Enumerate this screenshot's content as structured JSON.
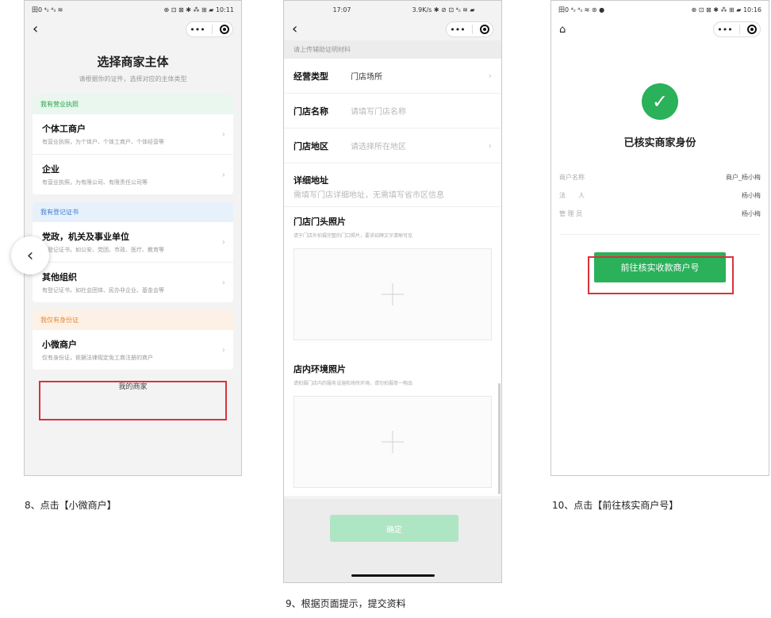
{
  "screen1": {
    "status_left": "田0 ⁴ᵢₗ ⁴ᵢₗ ≋",
    "status_right": "⊕ ⊡ ⊠ ✱ ⁂ ⊞ ▰ 10:11",
    "title": "选择商家主体",
    "subtitle": "请根据你的证件，选择对应的主体类型",
    "groups": [
      {
        "header": "我有营业执照",
        "options": [
          {
            "title": "个体工商户",
            "desc": "有营业执照，为个体户、个体工商户、个体经营等"
          },
          {
            "title": "企业",
            "desc": "有营业执照，为有限公司、有限责任公司等"
          }
        ]
      },
      {
        "header": "我有登记证书",
        "options": [
          {
            "title": "党政，机关及事业单位",
            "desc": "有登记证书，如公安、党团、市政、医疗、教育等"
          },
          {
            "title": "其他组织",
            "desc": "有登记证书，如社会团体、民办非企业、基金会等"
          }
        ]
      },
      {
        "header": "我仅有身份证",
        "options": [
          {
            "title": "小微商户",
            "desc": "仅有身份证，依据法律规定免工商注册的商户"
          }
        ]
      }
    ],
    "link": "我的商家"
  },
  "screen2": {
    "status_left": "17:07",
    "status_right": "3.9K/s ✱ ⊘ ⊡ ⁴ᵢₗ ≋ ▰",
    "hint": "请上传辅助证明材料",
    "type_label": "经营类型",
    "type_value": "门店场所",
    "name_label": "门店名称",
    "name_placeholder": "请填写门店名称",
    "region_label": "门店地区",
    "region_placeholder": "请选择所在地区",
    "address_label": "详细地址",
    "address_placeholder": "需填写门店详细地址，无需填写省市区信息",
    "front_photo_label": "门店门头照片",
    "front_photo_note": "请于门店外拍摄完整的门口照片，要求招牌文字清晰可见",
    "inside_photo_label": "店内环境照片",
    "inside_photo_note": "请拍摄门店内的服务设施和场所环境，请勿拍摄单一物品",
    "confirm": "确定"
  },
  "screen3": {
    "status_left": "田0 ⁴ᵢₗ ⁴ᵢₗ ≋ ⊛ ●",
    "status_right": "⊕ ⊡ ⊠ ✱ ⁂ ⊞ ▰ 10:16",
    "title": "已核实商家身份",
    "rows": [
      {
        "key": "商户名称",
        "value": "商户_杨小梅"
      },
      {
        "key": "法　　人",
        "value": "杨小梅"
      },
      {
        "key": "管 理 员",
        "value": "杨小梅"
      }
    ],
    "button": "前往核实收款商户号"
  },
  "captions": {
    "step8": "8、点击【小微商户】",
    "step9": "9、根据页面提示，提交资料",
    "step10": "10、点击【前往核实商户号】"
  },
  "colors": {
    "green": "#2ab15a",
    "highlight_red": "#d9323d",
    "disabled_green": "#aee5c3"
  },
  "icons": [
    "back-icon",
    "more-icon",
    "target-icon",
    "chevron-right-icon",
    "plus-icon",
    "home-icon",
    "check-icon"
  ]
}
